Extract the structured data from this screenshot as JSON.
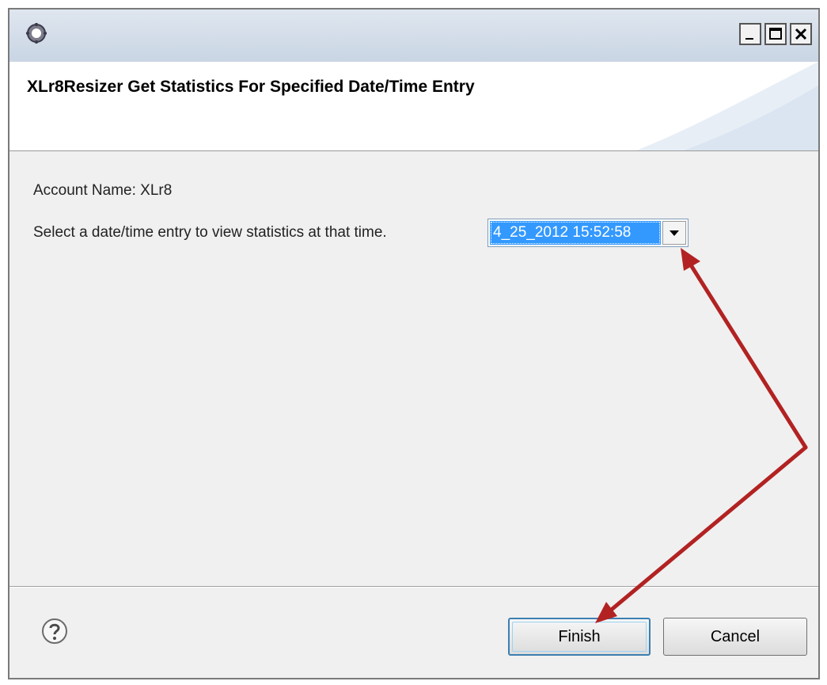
{
  "window": {
    "icon": "gear-icon",
    "controls": {
      "minimize_icon": "minimize-icon",
      "maximize_icon": "maximize-icon",
      "close_icon": "close-icon"
    }
  },
  "header": {
    "title": "XLr8Resizer Get Statistics For Specified Date/Time Entry"
  },
  "content": {
    "account_label": "Account Name: XLr8",
    "select_prompt": "Select a date/time entry to view statistics at that time.",
    "date_combo": {
      "selected_value": "4_25_2012 15:52:58",
      "arrow_icon": "chevron-down-icon"
    }
  },
  "footer": {
    "help_icon": "help-icon",
    "finish_label": "Finish",
    "cancel_label": "Cancel"
  },
  "annotations": {
    "arrow_color": "#b22222"
  },
  "colors": {
    "selection": "#3399ff",
    "dialog_background": "#f0f0f0",
    "titlebar": "#c9d5e4"
  }
}
